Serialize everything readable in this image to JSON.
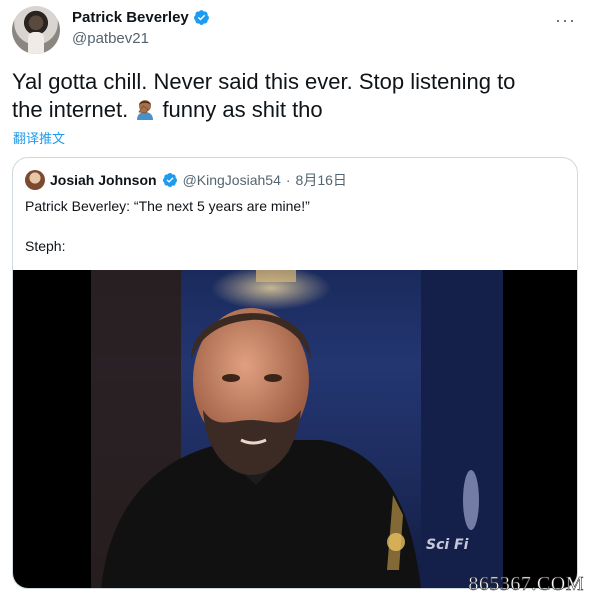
{
  "author": {
    "display_name": "Patrick Beverley",
    "handle": "@patbev21"
  },
  "tweet": {
    "text_line1": "Yal gotta chill. Never said this ever. Stop listening to",
    "text_line2_a": "the internet.",
    "text_line2_b": "funny as shit tho",
    "emoji": "man-facepalming-emoji",
    "translate_label": "翻译推文"
  },
  "quoted": {
    "display_name": "Josiah Johnson",
    "handle": "@KingJosiah54",
    "separator": "·",
    "date": "8月16日",
    "line1": "Patrick Beverley: “The next 5 years are mine!”",
    "line2": "Steph:"
  },
  "media": {
    "channel_logo": "Sci Fi"
  },
  "watermark": "865367.COM",
  "colors": {
    "link": "#1d9bf0",
    "verified": "#1d9bf0",
    "muted": "#536471",
    "border": "#cfd9de"
  }
}
